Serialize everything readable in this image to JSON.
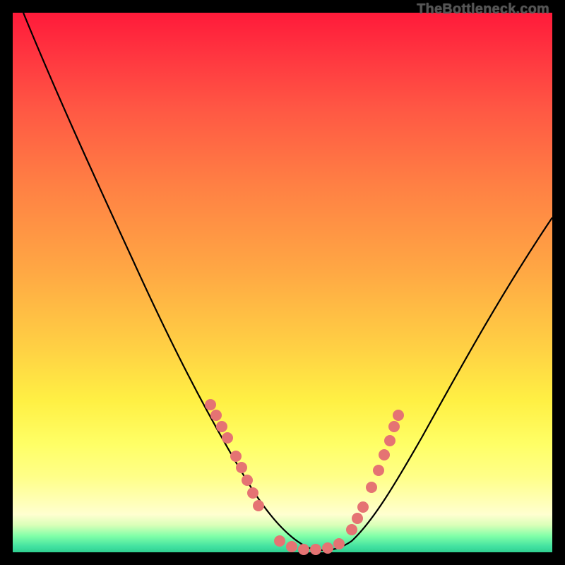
{
  "watermark": "TheBottleneck.com",
  "colors": {
    "frame": "#000000",
    "gradient_top": "#ff1a3a",
    "gradient_bottom": "#30d090",
    "line": "#000000",
    "dot": "#e57373"
  },
  "chart_data": {
    "type": "line",
    "title": "",
    "xlabel": "",
    "ylabel": "",
    "xlim": [
      0,
      100
    ],
    "ylim": [
      0,
      100
    ],
    "grid": false,
    "series": [
      {
        "name": "bottleneck-curve",
        "x": [
          2,
          6,
          10,
          14,
          18,
          22,
          26,
          30,
          34,
          37,
          40,
          43,
          46,
          49,
          52,
          55,
          58,
          61,
          65,
          70,
          76,
          82,
          88,
          94,
          100
        ],
        "y": [
          100,
          92,
          83,
          74,
          65,
          56,
          48,
          40,
          32,
          26,
          20,
          14,
          9,
          5,
          2,
          0,
          0,
          2,
          8,
          16,
          26,
          36,
          45,
          54,
          62
        ]
      }
    ],
    "points": [
      {
        "name": "left-cluster",
        "xy": [
          [
            36,
            28
          ],
          [
            37,
            26
          ],
          [
            38,
            24
          ],
          [
            39,
            22
          ],
          [
            41,
            18
          ],
          [
            42,
            16
          ],
          [
            43,
            13
          ],
          [
            44,
            11
          ],
          [
            45,
            8
          ]
        ]
      },
      {
        "name": "bottom-cluster",
        "xy": [
          [
            48,
            1
          ],
          [
            50,
            0
          ],
          [
            52,
            0
          ],
          [
            54,
            0
          ],
          [
            56,
            0
          ],
          [
            58,
            1
          ]
        ]
      },
      {
        "name": "right-cluster",
        "xy": [
          [
            60,
            4
          ],
          [
            61,
            6
          ],
          [
            62,
            8
          ],
          [
            64,
            12
          ],
          [
            66,
            16
          ],
          [
            67,
            20
          ],
          [
            68,
            23
          ],
          [
            69,
            26
          ],
          [
            70,
            28
          ]
        ]
      }
    ],
    "annotations": []
  }
}
